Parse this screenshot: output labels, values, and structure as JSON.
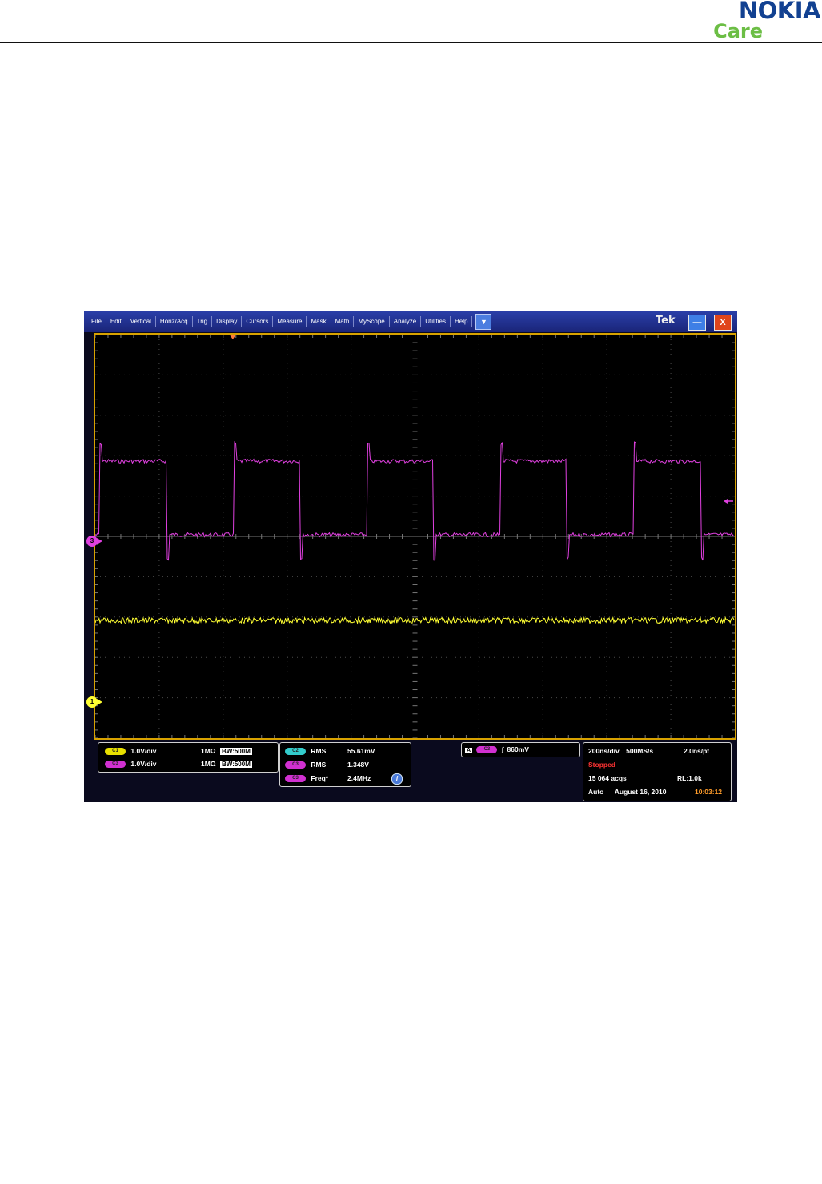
{
  "header": {
    "brand_name": "NOKIA",
    "brand_sub": "Care"
  },
  "menu": [
    "File",
    "Edit",
    "Vertical",
    "Horiz/Acq",
    "Trig",
    "Display",
    "Cursors",
    "Measure",
    "Mask",
    "Math",
    "MyScope",
    "Analyze",
    "Utilities",
    "Help"
  ],
  "window": {
    "title": "Tek",
    "minimize_label": "—",
    "close_label": "X",
    "dropdown_label": "▼"
  },
  "colors": {
    "ch1": "#ffff33",
    "ch3": "#e040e0",
    "ch2": "#33cccc",
    "grid": "#4a4a4a",
    "frame": "#d8a200"
  },
  "markers": {
    "ch3": "3",
    "ch1": "1"
  },
  "channels": [
    {
      "badge": "C1",
      "scale": "1.0V/div",
      "impedance": "1MΩ",
      "bw_prefix": "B",
      "bw": "W:500M"
    },
    {
      "badge": "C3",
      "scale": "1.0V/div",
      "impedance": "1MΩ",
      "bw_prefix": "B",
      "bw": "W:500M"
    }
  ],
  "measurements": [
    {
      "badge": "C2",
      "name": "RMS",
      "value": "55.61mV"
    },
    {
      "badge": "C3",
      "name": "RMS",
      "value": "1.348V"
    },
    {
      "badge": "C3",
      "name": "Freq*",
      "value": "2.4MHz"
    }
  ],
  "info_icon": "i",
  "trigger": {
    "label": "A",
    "badge": "C3",
    "slope": "∫",
    "level": "860mV"
  },
  "acquisition": {
    "timebase": "200ns/div",
    "sample_rate": "500MS/s",
    "resolution": "2.0ns/pt",
    "state": "Stopped",
    "acqs": "15 064 acqs",
    "record_length": "RL:1.0k",
    "mode": "Auto",
    "date": "August 16, 2010",
    "time": "10:03:12"
  },
  "icons": [
    "dropdown-arrow-icon",
    "minimize-icon",
    "close-icon",
    "trigger-position-icon",
    "info-icon",
    "trigger-level-arrow-icon"
  ]
}
